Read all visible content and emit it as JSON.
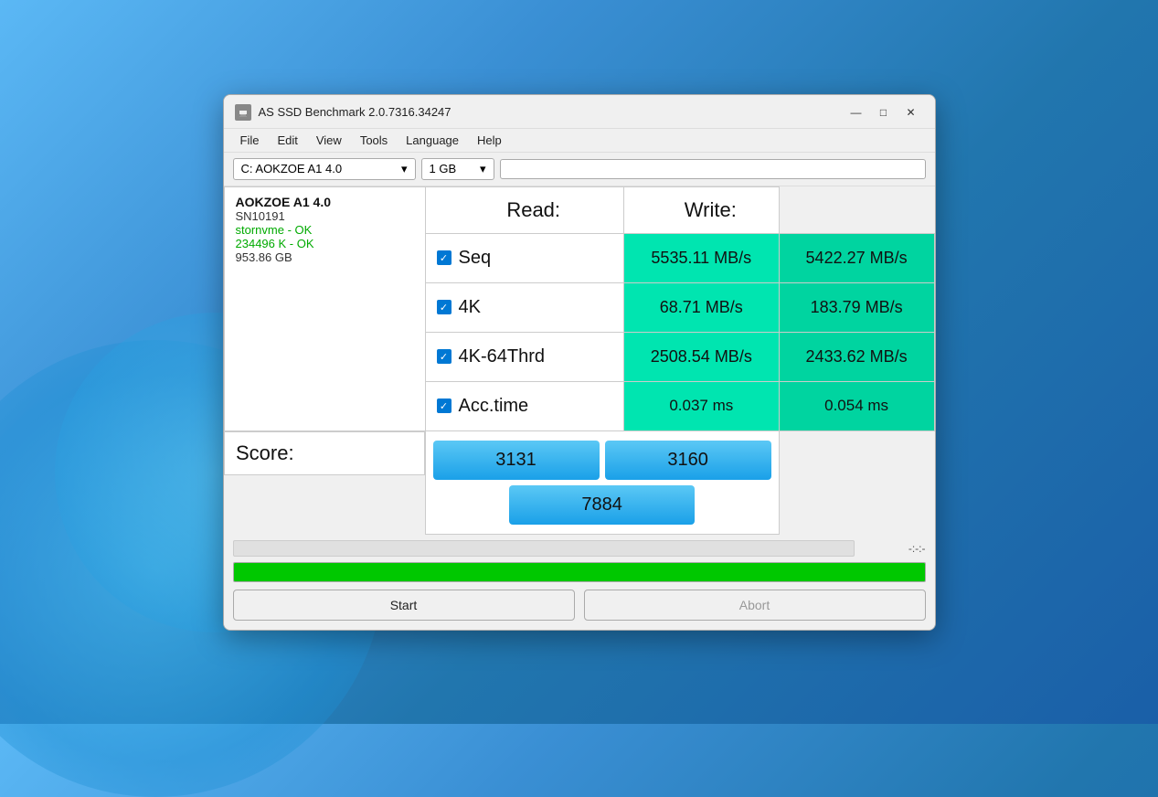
{
  "window": {
    "title": "AS SSD Benchmark 2.0.7316.34247",
    "icon_label": "disk"
  },
  "window_controls": {
    "minimize": "—",
    "maximize": "□",
    "close": "✕"
  },
  "menu": {
    "items": [
      "File",
      "Edit",
      "View",
      "Tools",
      "Language",
      "Help"
    ]
  },
  "toolbar": {
    "drive_label": "C: AOKZOE A1 4.0",
    "drive_arrow": "▾",
    "size_label": "1 GB",
    "size_arrow": "▾"
  },
  "info": {
    "device_name": "AOKZOE A1 4.0",
    "serial": "SN10191",
    "driver": "stornvme - OK",
    "size_status": "234496 K - OK",
    "capacity": "953.86 GB"
  },
  "headers": {
    "read": "Read:",
    "write": "Write:"
  },
  "rows": [
    {
      "id": "seq",
      "label": "Seq",
      "checked": true,
      "read": "5535.11 MB/s",
      "write": "5422.27 MB/s"
    },
    {
      "id": "4k",
      "label": "4K",
      "checked": true,
      "read": "68.71 MB/s",
      "write": "183.79 MB/s"
    },
    {
      "id": "4k64thrd",
      "label": "4K-64Thrd",
      "checked": true,
      "read": "2508.54 MB/s",
      "write": "2433.62 MB/s"
    },
    {
      "id": "acctime",
      "label": "Acc.time",
      "checked": true,
      "read": "0.037 ms",
      "write": "0.054 ms"
    }
  ],
  "score": {
    "label": "Score:",
    "read": "3131",
    "write": "3160",
    "total": "7884"
  },
  "status": {
    "time_display": "-:-:-",
    "progress_pct": 100
  },
  "buttons": {
    "start": "Start",
    "abort": "Abort"
  }
}
